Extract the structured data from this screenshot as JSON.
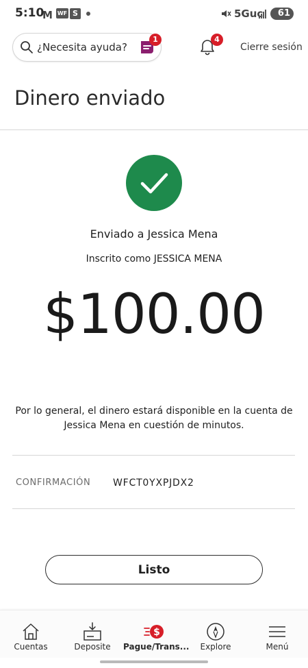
{
  "status_bar": {
    "time": "5:10",
    "gmail_icon": "M",
    "wf_icon": "WF",
    "s_icon": "S",
    "network": "5Guc",
    "battery": "61"
  },
  "header": {
    "search_placeholder": "¿Necesita ayuda?",
    "assistant_badge": "1",
    "notifications_badge": "4",
    "logout_label": "Cierre sesión"
  },
  "page": {
    "title": "Dinero enviado"
  },
  "confirmation": {
    "sent_to": "Enviado a Jessica Mena",
    "enrolled_as": "Inscrito como JESSICA MENA",
    "amount": "$100.00",
    "availability": "Por lo general, el dinero estará disponible en la cuenta de Jessica Mena en cuestión de minutos.",
    "label": "CONFIRMACIÓN",
    "code": "WFCT0YXPJDX2",
    "done_label": "Listo"
  },
  "colors": {
    "success": "#1e8a4c",
    "badge": "#d71e28",
    "assistant": "#8b1e6e"
  },
  "bottom_nav": {
    "items": [
      {
        "label": "Cuentas",
        "icon": "home-icon"
      },
      {
        "label": "Deposite",
        "icon": "deposit-icon"
      },
      {
        "label": "Pague/Trans...",
        "icon": "pay-transfer-icon",
        "active": true
      },
      {
        "label": "Explore",
        "icon": "compass-icon"
      },
      {
        "label": "Menú",
        "icon": "menu-icon"
      }
    ]
  }
}
